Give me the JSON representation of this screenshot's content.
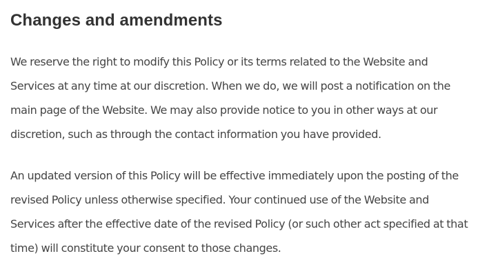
{
  "section": {
    "heading": "Changes and amendments",
    "paragraphs": [
      "We reserve the right to modify this Policy or its terms related to the Website and Services at any time at our discretion. When we do, we will post a notification on the main page of the Website. We may also provide notice to you in other ways at our discretion, such as through the contact information you have provided.",
      "An updated version of this Policy will be effective immediately upon the posting of the revised Policy unless otherwise specified. Your continued use of the Website and Services after the effective date of the revised Policy (or such other act specified at that time) will constitute your consent to those changes."
    ]
  }
}
